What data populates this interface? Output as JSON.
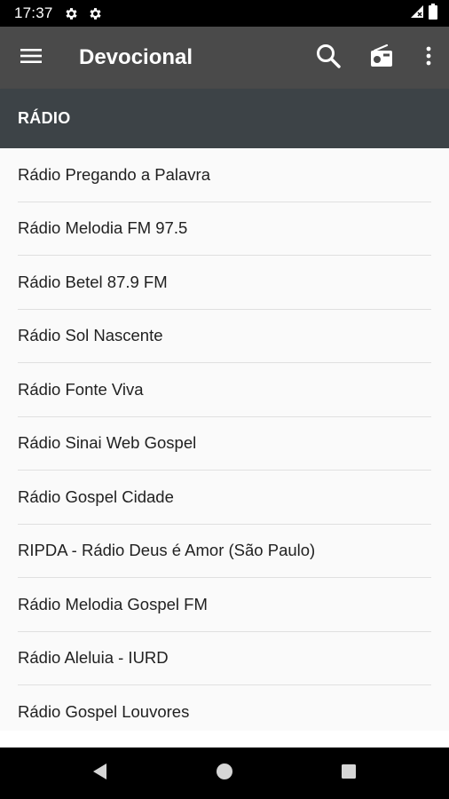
{
  "status_bar": {
    "time": "17:37",
    "icons": [
      "settings-gear-icon",
      "settings-gear-icon",
      "signal-icon",
      "battery-icon"
    ]
  },
  "app_bar": {
    "title": "Devocional",
    "actions": [
      "menu-icon",
      "search-icon",
      "radio-icon",
      "more-vert-icon"
    ]
  },
  "section": {
    "label": "RÁDIO"
  },
  "radios": [
    "Rádio Pregando a Palavra",
    "Rádio Melodia FM 97.5",
    "Rádio Betel 87.9 FM",
    "Rádio Sol Nascente",
    "Rádio Fonte Viva",
    "Rádio Sinai Web Gospel",
    "Rádio Gospel Cidade",
    "RIPDA - Rádio Deus é Amor (São Paulo)",
    "Rádio Melodia Gospel FM",
    "Rádio Aleluia - IURD",
    "Rádio Gospel Louvores"
  ],
  "nav_bar": {
    "buttons": [
      "back-icon",
      "home-icon",
      "recents-icon"
    ]
  },
  "colors": {
    "app_bar": "#4a4a4a",
    "section_header": "#3d4347",
    "list_background": "#fafafa",
    "status_bar": "#000000"
  }
}
